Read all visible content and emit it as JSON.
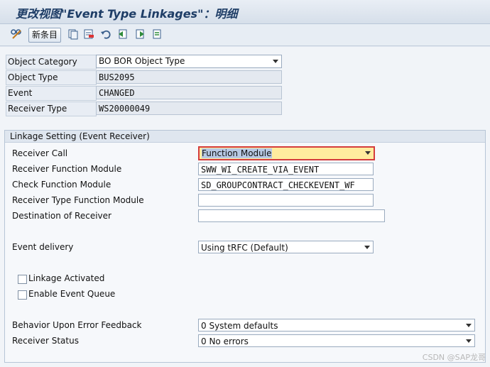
{
  "window": {
    "title": "更改视图\"Event Type Linkages\"：明细"
  },
  "toolbar": {
    "new_entries_label": "新条目"
  },
  "header_fields": [
    {
      "label": "Object Category",
      "value": "BO BOR Object Type"
    },
    {
      "label": "Object Type",
      "value": "BUS2095"
    },
    {
      "label": "Event",
      "value": "CHANGED"
    },
    {
      "label": "Receiver Type",
      "value": "WS20000049"
    }
  ],
  "linkage": {
    "title": "Linkage Setting (Event Receiver)",
    "receiver_call": {
      "label": "Receiver Call",
      "value": "Function Module"
    },
    "receiver_function_module": {
      "label": "Receiver Function Module",
      "value": "SWW_WI_CREATE_VIA_EVENT"
    },
    "check_function_module": {
      "label": "Check Function Module",
      "value": "SD_GROUPCONTRACT_CHECKEVENT_WF"
    },
    "receiver_type_function_module": {
      "label": "Receiver Type Function Module",
      "value": ""
    },
    "destination_of_receiver": {
      "label": "Destination of Receiver",
      "value": ""
    },
    "event_delivery": {
      "label": "Event delivery",
      "value": "Using tRFC (Default)"
    },
    "linkage_activated": {
      "label": "Linkage Activated",
      "checked": false
    },
    "enable_event_queue": {
      "label": "Enable Event Queue",
      "checked": false
    },
    "behavior_error": {
      "label": "Behavior Upon Error Feedback",
      "value": "0 System defaults"
    },
    "receiver_status": {
      "label": "Receiver Status",
      "value": "0 No errors"
    }
  },
  "watermark": "CSDN @SAP龙哥",
  "colors": {
    "title": "#1e3d66",
    "focus_border": "#d43c3c",
    "highlight": "#ffec9e"
  }
}
